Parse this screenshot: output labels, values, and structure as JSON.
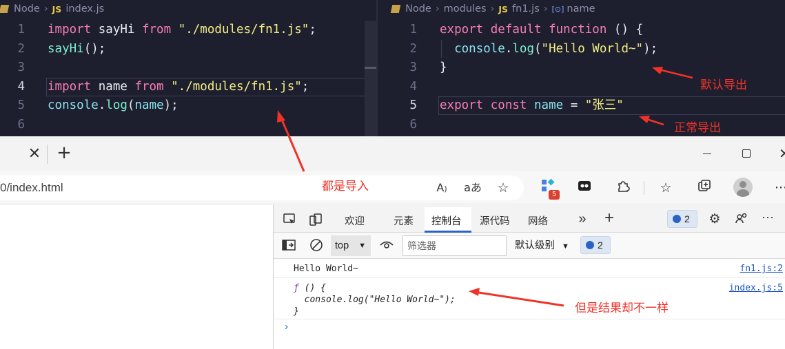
{
  "left_editor": {
    "breadcrumb": {
      "folder": "Node",
      "file_badge": "JS",
      "file": "index.js"
    },
    "lines": [
      {
        "num": "1",
        "tokens": [
          [
            "kw",
            "import"
          ],
          [
            "pl",
            " sayHi "
          ],
          [
            "kw",
            "from"
          ],
          [
            "pl",
            " "
          ],
          [
            "str",
            "\"./modules/fn1.js\""
          ],
          [
            "pl",
            ";"
          ]
        ]
      },
      {
        "num": "2",
        "tokens": [
          [
            "fn",
            "sayHi"
          ],
          [
            "pl",
            "();"
          ]
        ]
      },
      {
        "num": "3",
        "tokens": []
      },
      {
        "num": "4",
        "tokens": [
          [
            "kw",
            "import"
          ],
          [
            "pl",
            " name "
          ],
          [
            "kw",
            "from"
          ],
          [
            "pl",
            " "
          ],
          [
            "str",
            "\"./modules/fn1.js\""
          ],
          [
            "pl",
            ";"
          ]
        ]
      },
      {
        "num": "5",
        "tokens": [
          [
            "pr",
            "console"
          ],
          [
            "pl",
            "."
          ],
          [
            "fn",
            "log"
          ],
          [
            "pl",
            "("
          ],
          [
            "pr",
            "name"
          ],
          [
            "pl",
            ");"
          ]
        ]
      },
      {
        "num": "6",
        "tokens": []
      }
    ]
  },
  "right_editor": {
    "breadcrumb": {
      "folder": "Node",
      "subfolder": "modules",
      "file_badge": "JS",
      "file": "fn1.js",
      "symbol_icon": "[⊙]",
      "symbol": "name"
    },
    "lines": [
      {
        "num": "1",
        "tokens": [
          [
            "kw",
            "export"
          ],
          [
            "pl",
            " "
          ],
          [
            "kw",
            "default"
          ],
          [
            "pl",
            " "
          ],
          [
            "kw",
            "function"
          ],
          [
            "pl",
            " () {"
          ]
        ]
      },
      {
        "num": "2",
        "tokens": [
          [
            "pl",
            "  "
          ],
          [
            "pr",
            "console"
          ],
          [
            "pl",
            "."
          ],
          [
            "fn",
            "log"
          ],
          [
            "pl",
            "("
          ],
          [
            "str",
            "\"Hello World~\""
          ],
          [
            "pl",
            ");"
          ]
        ]
      },
      {
        "num": "3",
        "tokens": [
          [
            "pl",
            "}"
          ]
        ]
      },
      {
        "num": "4",
        "tokens": []
      },
      {
        "num": "5",
        "tokens": [
          [
            "kw",
            "export"
          ],
          [
            "pl",
            " "
          ],
          [
            "kw",
            "const"
          ],
          [
            "pl",
            " "
          ],
          [
            "pr",
            "name"
          ],
          [
            "pl",
            " = "
          ],
          [
            "str",
            "\"张三\""
          ]
        ]
      },
      {
        "num": "6",
        "tokens": []
      }
    ]
  },
  "browser": {
    "tab_close": "✕",
    "new_tab": "+",
    "url": "0/index.html",
    "toolbar_icons": [
      "read-aloud-icon",
      "translate-icon",
      "add-favorite-icon",
      "extensions-icon",
      "immersive-reader-icon",
      "puzzle-icon",
      "favorites-icon",
      "collections-icon",
      "profile-icon",
      "more-icon"
    ],
    "extension_badge": "5"
  },
  "devtools": {
    "tabs": [
      "欢迎",
      "元素",
      "控制台",
      "源代码",
      "网络"
    ],
    "active_tab": "控制台",
    "more_tabs": "»",
    "add_tab": "+",
    "message_count": "2",
    "context": "top",
    "filter_placeholder": "筛选器",
    "level": "默认级别",
    "issue_count": "2",
    "console": [
      {
        "text": "Hello World~",
        "source": "fn1.js:2"
      },
      {
        "f": "ƒ",
        "line1": " () {",
        "line2": "  console.log(\"Hello World~\");",
        "line3": "}",
        "source": "index.js:5"
      }
    ],
    "prompt": "›"
  },
  "annotations": {
    "default_export": "默认导出",
    "normal_export": "正常导出",
    "both_import": "都是导入",
    "different_result": "但是结果却不一样"
  }
}
